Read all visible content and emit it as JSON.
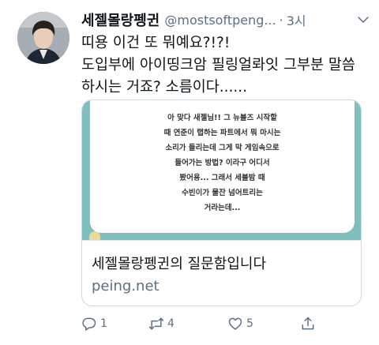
{
  "tweet": {
    "display_name": "세젤몰랑펭귄",
    "handle": "@mostsoftpeng...",
    "separator": "·",
    "time": "3시",
    "text": "띠용 이건 또 뭐예요?!?!\n도입부에 아이띵크암 필링얼롸잇 그부분 말씀\n하시는 거죠? 소름이다......"
  },
  "card": {
    "question_text": "아 맞다 새젤님!! 그 뉴블즈 시작할\n때 연준이 랩하는 파트에서 뭐 마시는\n소리가 들리는데 그게 막 게임속으로\n들어가는 방법? 이라구 어디서\n봤어용... 그래서 세블밤 때\n수빈이가 물잔 넘어트리는\n거라는데...",
    "title": "세젤몰랑펭귄의 질문함입니다",
    "domain": "peing.net",
    "media_color": "#81bfbf"
  },
  "actions": {
    "reply_count": "1",
    "retweet_count": "4",
    "like_count": "5"
  },
  "icons": {
    "avatar": "avatar",
    "caret": "chevron-down-icon",
    "reply": "reply-icon",
    "retweet": "retweet-icon",
    "like": "heart-icon",
    "share": "share-icon"
  }
}
